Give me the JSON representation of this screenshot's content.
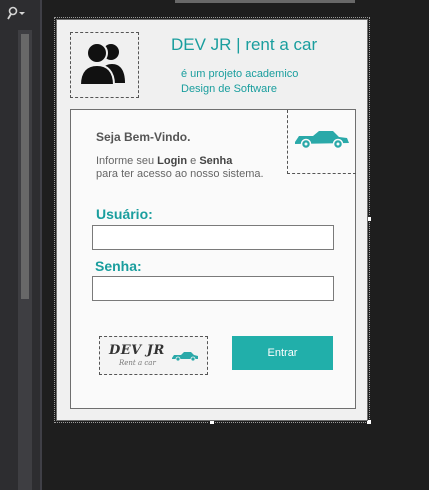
{
  "app": {
    "title": "DEV JR | rent a car",
    "subtitle_line1": "é um projeto academico",
    "subtitle_line2": "Design de Software"
  },
  "welcome": {
    "greeting": "Seja Bem-Vindo.",
    "info_prefix": "Informe seu ",
    "info_login": "Login",
    "info_and": " e ",
    "info_password": "Senha",
    "info_line2": "para ter acesso ao nosso sistema."
  },
  "login": {
    "username_label": "Usuário:",
    "username_value": "",
    "password_label": "Senha:",
    "password_value": "",
    "submit_label": "Entrar"
  },
  "logo": {
    "main_text": "DEV JR",
    "sub_text": "Rent a car"
  },
  "colors": {
    "accent": "#1a9e9e",
    "button": "#21afaa",
    "ide_background": "#1e1e1e",
    "form_background": "#f0f0f0"
  },
  "icons": {
    "toolbar": "search-icon",
    "user_image": "users-icon",
    "header_car": "car-icon",
    "logo_car": "car-icon"
  }
}
